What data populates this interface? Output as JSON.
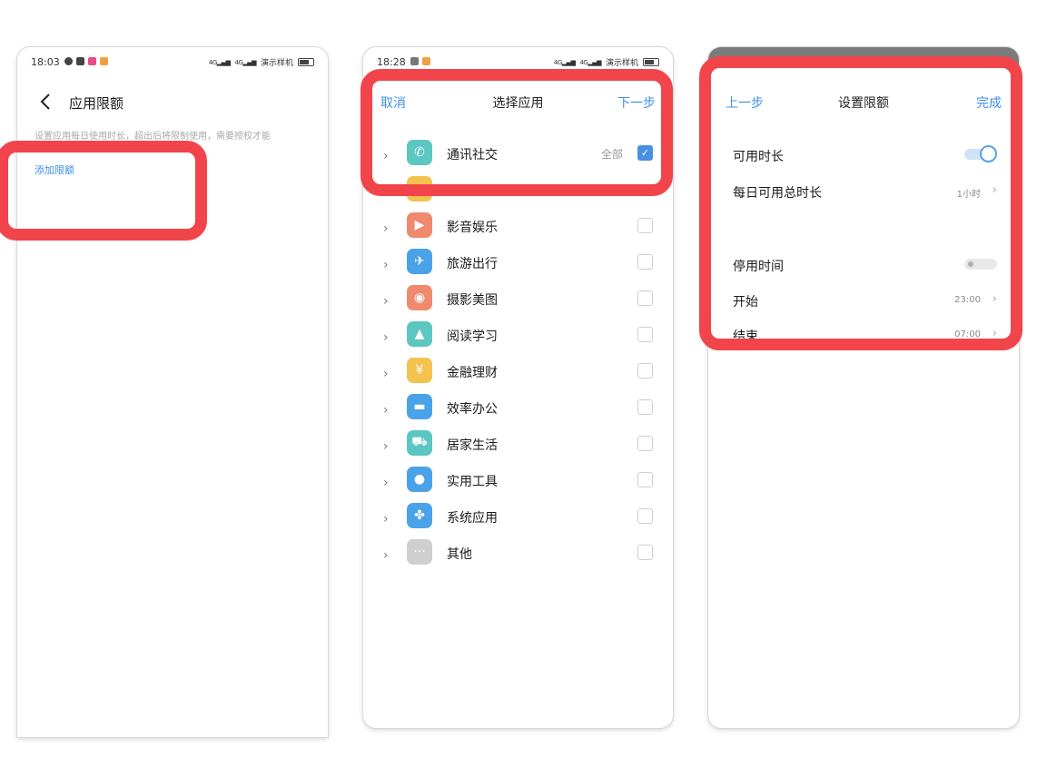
{
  "screen1": {
    "time": "18:03",
    "carrier": "演示样机",
    "title": "应用限额",
    "description": "设置应用每日使用时长，超出后将限制使用，需要授权才能",
    "add_link": "添加限额"
  },
  "screen2": {
    "time": "18:28",
    "carrier": "演示样机",
    "cancel": "取消",
    "title": "选择应用",
    "next": "下一步",
    "all_label": "全部",
    "categories": [
      {
        "label": "通讯社交",
        "checked": true,
        "color": "#5cc7c1"
      },
      {
        "label": "",
        "checked": false,
        "color": "#f4c24f"
      },
      {
        "label": "影音娱乐",
        "checked": false,
        "color": "#ef8a6e"
      },
      {
        "label": "旅游出行",
        "checked": false,
        "color": "#4aa3e8"
      },
      {
        "label": "摄影美图",
        "checked": false,
        "color": "#ef8a6e"
      },
      {
        "label": "阅读学习",
        "checked": false,
        "color": "#5cc7c1"
      },
      {
        "label": "金融理财",
        "checked": false,
        "color": "#f4c24f"
      },
      {
        "label": "效率办公",
        "checked": false,
        "color": "#4aa3e8"
      },
      {
        "label": "居家生活",
        "checked": false,
        "color": "#5cc7c1"
      },
      {
        "label": "实用工具",
        "checked": false,
        "color": "#4aa3e8"
      },
      {
        "label": "系统应用",
        "checked": false,
        "color": "#4aa3e8"
      },
      {
        "label": "其他",
        "checked": false,
        "color": "#cfcfcf"
      }
    ]
  },
  "screen3": {
    "prev": "上一步",
    "title": "设置限额",
    "done": "完成",
    "available_duration": "可用时长",
    "daily_total": "每日可用总时长",
    "daily_total_value": "1小时",
    "downtime": "停用时间",
    "start": "开始",
    "start_value": "23:00",
    "end": "结束",
    "end_value": "07:00"
  },
  "colors": {
    "accent": "#3f8ee8",
    "highlight": "#f2444b"
  }
}
